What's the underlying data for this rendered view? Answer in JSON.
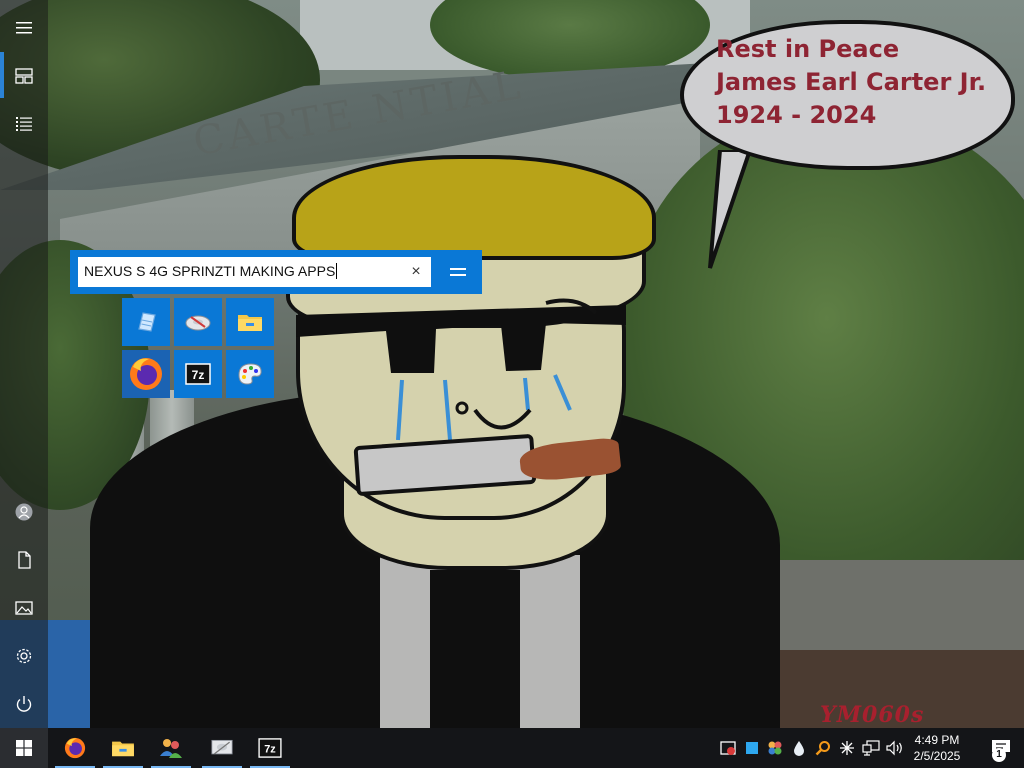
{
  "wallpaper": {
    "building_sign": "CARTE        NTIAL",
    "speech_bubble": {
      "line1": "Rest in Peace",
      "line2": "James Earl Carter Jr.",
      "line3": "1924 - 2024"
    },
    "watermark": "YM060s",
    "colors": {
      "bubble_text": "#8e2433",
      "hat": "#b8a318",
      "skin": "#d5d2ad"
    }
  },
  "start_rail": {
    "items": [
      {
        "icon": "hamburger-icon"
      },
      {
        "icon": "tiles-icon"
      },
      {
        "icon": "all-apps-icon"
      },
      {
        "icon": "user-icon"
      },
      {
        "icon": "documents-icon"
      },
      {
        "icon": "pictures-icon"
      },
      {
        "icon": "settings-icon"
      },
      {
        "icon": "power-icon"
      }
    ]
  },
  "search": {
    "value": "NEXUS S 4G SPRINZTI MAKING APPS",
    "clear_glyph": "×"
  },
  "tiles": [
    {
      "icon": "notepad-icon"
    },
    {
      "icon": "disk-cleanup-icon"
    },
    {
      "icon": "file-explorer-icon"
    },
    {
      "icon": "firefox-icon"
    },
    {
      "icon": "7zip-icon",
      "label": "7z"
    },
    {
      "icon": "paint-icon"
    }
  ],
  "taskbar": {
    "apps": [
      {
        "icon": "firefox-icon"
      },
      {
        "icon": "file-explorer-icon"
      },
      {
        "icon": "network-users-icon"
      },
      {
        "icon": "disk-cleanup-icon"
      },
      {
        "icon": "7zip-icon",
        "label": "7z"
      }
    ],
    "tray_icons": [
      "antivirus-icon",
      "blue-square-icon",
      "colorful-app-icon",
      "water-drop-icon",
      "search-tool-icon",
      "sparkle-icon",
      "network-icon",
      "volume-icon"
    ],
    "clock": {
      "time": "4:49 PM",
      "date": "2/5/2025"
    },
    "notification_count": "1",
    "accent_color": "#0a78d6"
  }
}
